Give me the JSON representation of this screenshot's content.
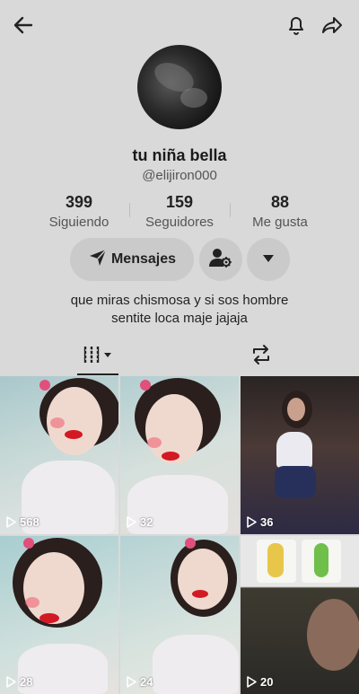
{
  "profile": {
    "display_name": "tu niña bella",
    "username": "@elijiron000",
    "avatar_icon": "profile-photo"
  },
  "stats": [
    {
      "value": "399",
      "label": "Siguiendo"
    },
    {
      "value": "159",
      "label": "Seguidores"
    },
    {
      "value": "88",
      "label": "Me gusta"
    }
  ],
  "actions": {
    "message_label": "Mensajes",
    "message_icon": "send-icon",
    "add_friend_icon": "add-friend-icon",
    "more_icon": "chevron-down-icon"
  },
  "bio": {
    "line1": "que miras chismosa y si sos hombre",
    "line2": "sentite loca maje jajaja"
  },
  "tabs": [
    {
      "name": "videos",
      "icon": "grid-icon",
      "active": true
    },
    {
      "name": "reposts",
      "icon": "repost-icon",
      "active": false
    }
  ],
  "videos": [
    {
      "views": "568"
    },
    {
      "views": "32"
    },
    {
      "views": "36"
    },
    {
      "views": "28"
    },
    {
      "views": "24"
    },
    {
      "views": "20"
    }
  ],
  "colors": {
    "background": "#d9d9d9",
    "button": "#cacaca",
    "text": "#1a1a1a",
    "secondary_text": "#555555"
  }
}
